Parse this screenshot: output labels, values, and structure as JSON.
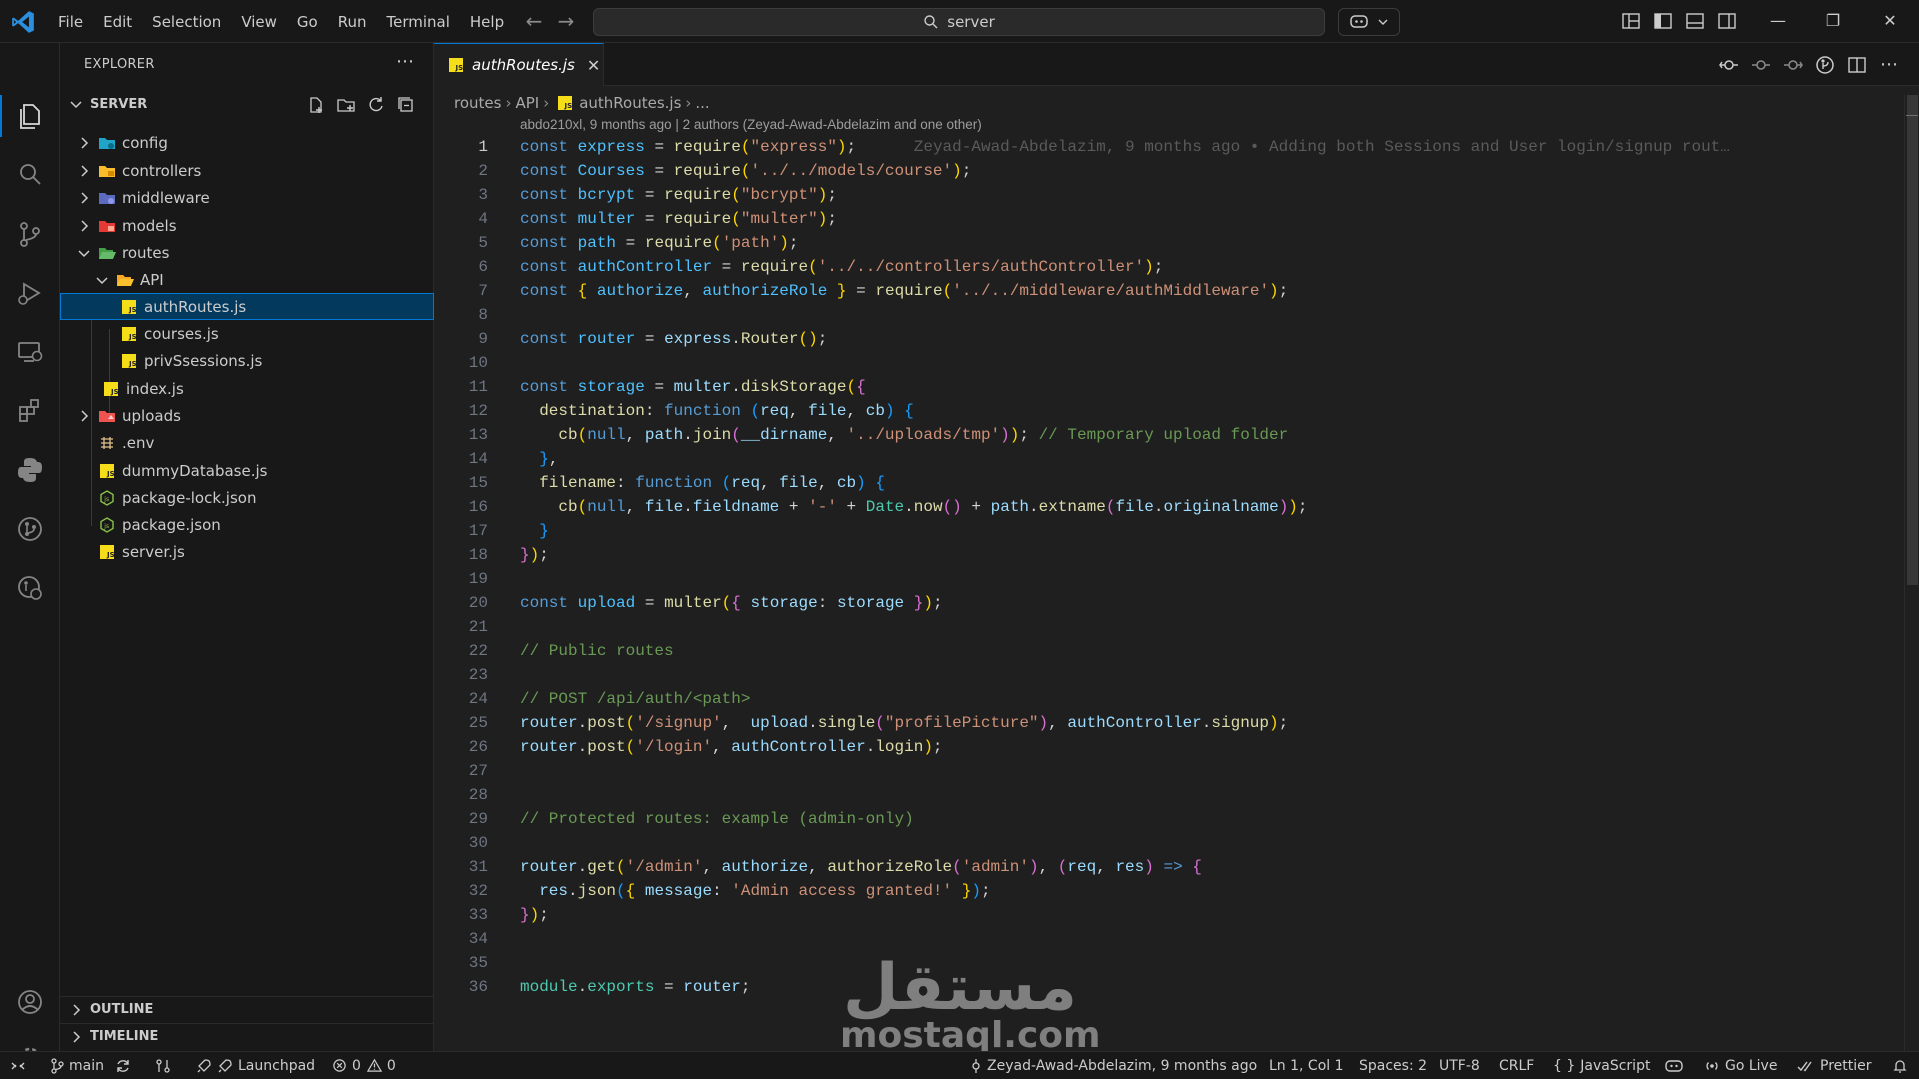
{
  "titlebar": {
    "menu": [
      "File",
      "Edit",
      "Selection",
      "View",
      "Go",
      "Run",
      "Terminal",
      "Help"
    ],
    "search_text": "server"
  },
  "sidebar": {
    "explorer_title": "EXPLORER",
    "folder_title": "SERVER",
    "tree": [
      {
        "label": "config",
        "type": "folder"
      },
      {
        "label": "controllers",
        "type": "folder"
      },
      {
        "label": "middleware",
        "type": "folder"
      },
      {
        "label": "models",
        "type": "folder"
      },
      {
        "label": "routes",
        "type": "folder-open"
      },
      {
        "label": "API",
        "type": "folder-open"
      },
      {
        "label": "authRoutes.js",
        "type": "js",
        "selected": true
      },
      {
        "label": "courses.js",
        "type": "js"
      },
      {
        "label": "privSsessions.js",
        "type": "js"
      },
      {
        "label": "index.js",
        "type": "js"
      },
      {
        "label": "uploads",
        "type": "folder"
      },
      {
        "label": ".env",
        "type": "env"
      },
      {
        "label": "dummyDatabase.js",
        "type": "js"
      },
      {
        "label": "package-lock.json",
        "type": "json"
      },
      {
        "label": "package.json",
        "type": "json"
      },
      {
        "label": "server.js",
        "type": "js"
      }
    ],
    "outline_label": "OUTLINE",
    "timeline_label": "TIMELINE"
  },
  "editor": {
    "tab_label": "authRoutes.js",
    "breadcrumb": [
      "routes",
      "API",
      "authRoutes.js",
      "..."
    ],
    "blame_header": "abdo210xl, 9 months ago | 2 authors (Zeyad-Awad-Abdelazim and one other)",
    "inline_blame": "Zeyad-Awad-Abdelazim, 9 months ago • Adding both Sessions and User login/signup rout…",
    "current_line": 1,
    "line_count": 36
  },
  "watermark": {
    "arabic": "مستقل",
    "latin": "mostaql.com"
  },
  "statusbar": {
    "branch": "main",
    "launchpad": "Launchpad",
    "errors": "0",
    "warnings": "0",
    "blame": "Zeyad-Awad-Abdelazim, 9 months ago",
    "cursor": "Ln 1, Col 1",
    "spaces": "Spaces: 2",
    "encoding": "UTF-8",
    "eol": "CRLF",
    "language": "JavaScript",
    "golive": "Go Live",
    "prettier": "Prettier"
  },
  "colors": {
    "accent": "#0078d4",
    "selection": "#04395e",
    "keyword": "#569cd6",
    "string": "#ce9178",
    "comment": "#6a9955",
    "function": "#dcdcaa",
    "variable": "#9cdcfe"
  }
}
